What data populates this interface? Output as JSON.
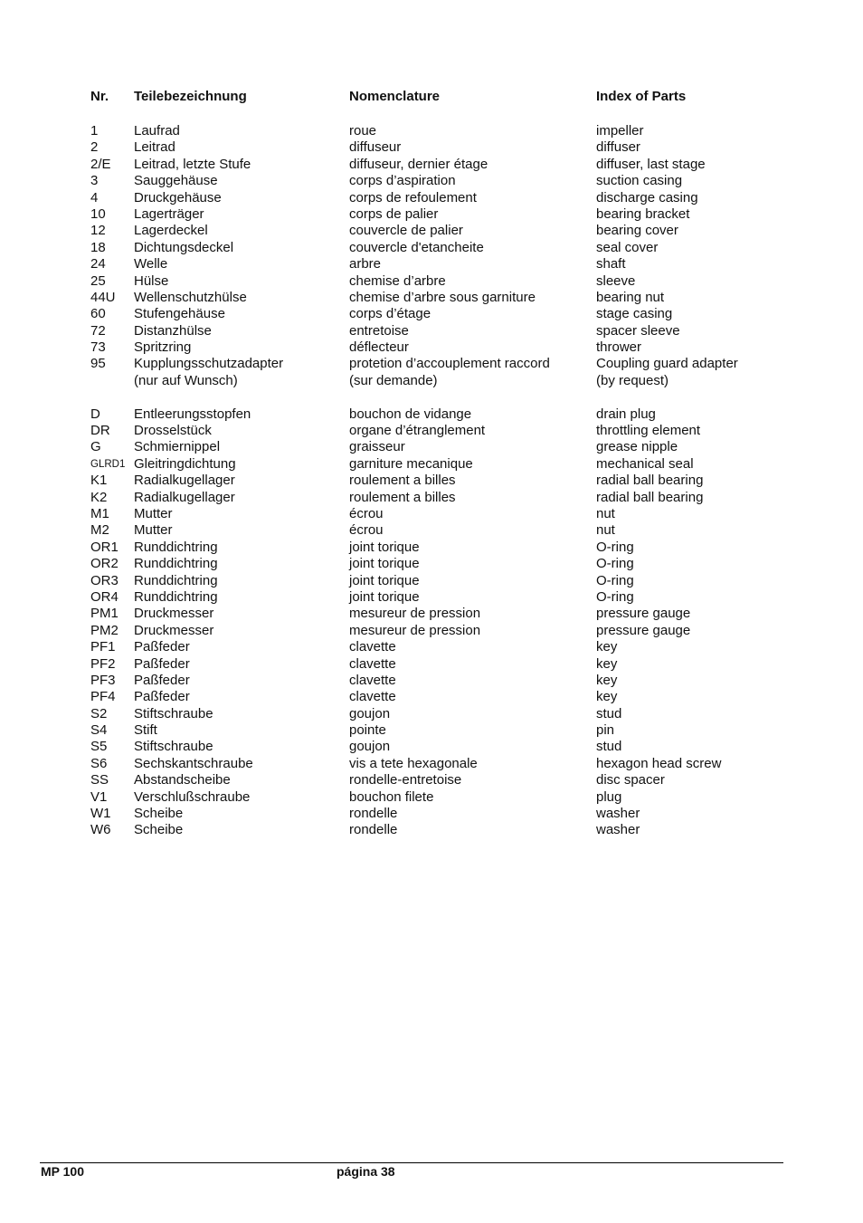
{
  "headers": {
    "nr": "Nr.",
    "german": "Teilebezeichnung",
    "french": "Nomenclature",
    "english": "Index of Parts"
  },
  "parts_group_1": [
    {
      "nr": "1",
      "de": "Laufrad",
      "fr": "roue",
      "en": "impeller"
    },
    {
      "nr": "2",
      "de": "Leitrad",
      "fr": "diffuseur",
      "en": "diffuser"
    },
    {
      "nr": "2/E",
      "de": "Leitrad, letzte Stufe",
      "fr": "diffuseur, dernier étage",
      "en": "diffuser, last stage"
    },
    {
      "nr": "3",
      "de": "Sauggehäuse",
      "fr": "corps d’aspiration",
      "en": "suction casing"
    },
    {
      "nr": "4",
      "de": "Druckgehäuse",
      "fr": "corps de refoulement",
      "en": "discharge casing"
    },
    {
      "nr": "10",
      "de": "Lagerträger",
      "fr": "corps de palier",
      "en": "bearing bracket"
    },
    {
      "nr": "12",
      "de": "Lagerdeckel",
      "fr": "couvercle de palier",
      "en": "bearing cover"
    },
    {
      "nr": "18",
      "de": "Dichtungsdeckel",
      "fr": "couvercle d'etancheite",
      "en": "seal cover"
    },
    {
      "nr": "24",
      "de": "Welle",
      "fr": "arbre",
      "en": "shaft"
    },
    {
      "nr": "25",
      "de": "Hülse",
      "fr": "chemise d’arbre",
      "en": "sleeve"
    },
    {
      "nr": "44U",
      "de": "Wellenschutzhülse",
      "fr": "chemise d’arbre sous garniture",
      "en": "bearing nut"
    },
    {
      "nr": "60",
      "de": "Stufengehäuse",
      "fr": "corps d’étage",
      "en": "stage casing"
    },
    {
      "nr": "72",
      "de": "Distanzhülse",
      "fr": "entretoise",
      "en": "spacer sleeve"
    },
    {
      "nr": "73",
      "de": "Spritzring",
      "fr": "déflecteur",
      "en": "thrower"
    },
    {
      "nr": "95",
      "de": "Kupplungsschutzadapter",
      "fr": "protetion d’accouplement raccord",
      "en": "Coupling guard adapter"
    },
    {
      "nr": "",
      "de": "(nur auf Wunsch)",
      "fr": "(sur demande)",
      "en": "(by request)"
    }
  ],
  "parts_group_2": [
    {
      "nr": "D",
      "de": "Entleerungsstopfen",
      "fr": "bouchon de vidange",
      "en": "drain plug"
    },
    {
      "nr": "DR",
      "de": "Drosselstück",
      "fr": "organe d’étranglement",
      "en": "throttling element"
    },
    {
      "nr": "G",
      "de": "Schmiernippel",
      "fr": "graisseur",
      "en": "grease nipple"
    },
    {
      "nr": "GLRD1",
      "de": "Gleitringdichtung",
      "fr": "garniture mecanique",
      "en": "mechanical seal"
    },
    {
      "nr": "K1",
      "de": "Radialkugellager",
      "fr": "roulement a billes",
      "en": "radial ball bearing"
    },
    {
      "nr": "K2",
      "de": "Radialkugellager",
      "fr": "roulement a billes",
      "en": "radial ball bearing"
    },
    {
      "nr": "M1",
      "de": "Mutter",
      "fr": "écrou",
      "en": "nut"
    },
    {
      "nr": "M2",
      "de": "Mutter",
      "fr": "écrou",
      "en": "nut"
    },
    {
      "nr": "OR1",
      "de": "Runddichtring",
      "fr": "joint torique",
      "en": "O-ring"
    },
    {
      "nr": "OR2",
      "de": "Runddichtring",
      "fr": "joint torique",
      "en": "O-ring"
    },
    {
      "nr": "OR3",
      "de": "Runddichtring",
      "fr": "joint torique",
      "en": "O-ring"
    },
    {
      "nr": "OR4",
      "de": "Runddichtring",
      "fr": "joint torique",
      "en": "O-ring"
    },
    {
      "nr": "PM1",
      "de": "Druckmesser",
      "fr": "mesureur de pression",
      "en": "pressure gauge"
    },
    {
      "nr": "PM2",
      "de": "Druckmesser",
      "fr": "mesureur de pression",
      "en": "pressure gauge"
    },
    {
      "nr": "PF1",
      "de": "Paßfeder",
      "fr": "clavette",
      "en": "key"
    },
    {
      "nr": "PF2",
      "de": "Paßfeder",
      "fr": "clavette",
      "en": "key"
    },
    {
      "nr": "PF3",
      "de": "Paßfeder",
      "fr": "clavette",
      "en": "key"
    },
    {
      "nr": "PF4",
      "de": "Paßfeder",
      "fr": "clavette",
      "en": "key"
    },
    {
      "nr": "S2",
      "de": "Stiftschraube",
      "fr": "goujon",
      "en": "stud"
    },
    {
      "nr": "S4",
      "de": "Stift",
      "fr": "pointe",
      "en": "pin"
    },
    {
      "nr": "S5",
      "de": "Stiftschraube",
      "fr": "goujon",
      "en": "stud"
    },
    {
      "nr": "S6",
      "de": "Sechskantschraube",
      "fr": "vis a tete hexagonale",
      "en": "hexagon head screw"
    },
    {
      "nr": "SS",
      "de": "Abstandscheibe",
      "fr": "rondelle-entretoise",
      "en": "disc spacer"
    },
    {
      "nr": "V1",
      "de": "Verschlußschraube",
      "fr": "bouchon filete",
      "en": "plug"
    },
    {
      "nr": "W1",
      "de": "Scheibe",
      "fr": "rondelle",
      "en": "washer"
    },
    {
      "nr": "W6",
      "de": "Scheibe",
      "fr": "rondelle",
      "en": "washer"
    }
  ],
  "footer": {
    "left": "MP 100",
    "center": "página 38"
  }
}
